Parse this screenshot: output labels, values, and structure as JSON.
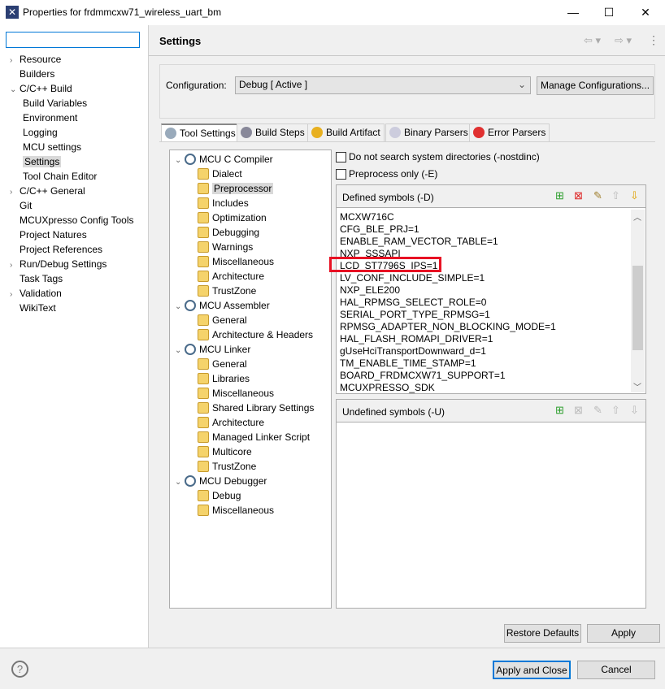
{
  "window": {
    "title": "Properties for frdmmcxw71_wireless_uart_bm",
    "minimize": "—",
    "maximize": "☐",
    "close": "✕"
  },
  "left_tree": [
    {
      "label": "Resource",
      "level": 0,
      "arrow": ">"
    },
    {
      "label": "Builders",
      "level": 0,
      "arrow": ""
    },
    {
      "label": "C/C++ Build",
      "level": 0,
      "arrow": "v"
    },
    {
      "label": "Build Variables",
      "level": 1,
      "arrow": ""
    },
    {
      "label": "Environment",
      "level": 1,
      "arrow": ""
    },
    {
      "label": "Logging",
      "level": 1,
      "arrow": ""
    },
    {
      "label": "MCU settings",
      "level": 1,
      "arrow": ""
    },
    {
      "label": "Settings",
      "level": 1,
      "arrow": "",
      "selected": true
    },
    {
      "label": "Tool Chain Editor",
      "level": 1,
      "arrow": ""
    },
    {
      "label": "C/C++ General",
      "level": 0,
      "arrow": ">"
    },
    {
      "label": "Git",
      "level": 0,
      "arrow": ""
    },
    {
      "label": "MCUXpresso Config Tools",
      "level": 0,
      "arrow": ""
    },
    {
      "label": "Project Natures",
      "level": 0,
      "arrow": ""
    },
    {
      "label": "Project References",
      "level": 0,
      "arrow": ""
    },
    {
      "label": "Run/Debug Settings",
      "level": 0,
      "arrow": ">"
    },
    {
      "label": "Task Tags",
      "level": 0,
      "arrow": ""
    },
    {
      "label": "Validation",
      "level": 0,
      "arrow": ">"
    },
    {
      "label": "WikiText",
      "level": 0,
      "arrow": ""
    }
  ],
  "header": {
    "title": "Settings",
    "back": "⇦ ▾",
    "forward": "⇨ ▾",
    "menu": "⋮"
  },
  "configuration": {
    "label": "Configuration:",
    "value": "Debug  [ Active ]",
    "manage": "Manage Configurations..."
  },
  "tabs": [
    {
      "label": "Tool Settings",
      "active": true,
      "icon": "tool-settings-icon"
    },
    {
      "label": "Build Steps",
      "icon": "build-steps-icon"
    },
    {
      "label": "Build Artifact",
      "icon": "trophy-icon"
    },
    {
      "label": "Binary Parsers",
      "icon": "binary-icon"
    },
    {
      "label": "Error Parsers",
      "icon": "error-icon"
    }
  ],
  "tool_tree": [
    {
      "label": "MCU C Compiler",
      "tool": true
    },
    {
      "label": "Dialect"
    },
    {
      "label": "Preprocessor",
      "selected": true
    },
    {
      "label": "Includes"
    },
    {
      "label": "Optimization"
    },
    {
      "label": "Debugging"
    },
    {
      "label": "Warnings"
    },
    {
      "label": "Miscellaneous"
    },
    {
      "label": "Architecture"
    },
    {
      "label": "TrustZone"
    },
    {
      "label": "MCU Assembler",
      "tool": true
    },
    {
      "label": "General"
    },
    {
      "label": "Architecture & Headers"
    },
    {
      "label": "MCU Linker",
      "tool": true
    },
    {
      "label": "General"
    },
    {
      "label": "Libraries"
    },
    {
      "label": "Miscellaneous"
    },
    {
      "label": "Shared Library Settings"
    },
    {
      "label": "Architecture"
    },
    {
      "label": "Managed Linker Script"
    },
    {
      "label": "Multicore"
    },
    {
      "label": "TrustZone"
    },
    {
      "label": "MCU Debugger",
      "tool": true
    },
    {
      "label": "Debug"
    },
    {
      "label": "Miscellaneous"
    }
  ],
  "options": {
    "nostdinc": "Do not search system directories (-nostdinc)",
    "preprocess_only": "Preprocess only (-E)"
  },
  "defined": {
    "title": "Defined symbols (-D)",
    "symbols": [
      "MCXW716C",
      "CFG_BLE_PRJ=1",
      "ENABLE_RAM_VECTOR_TABLE=1",
      "NXP_SSSAPI",
      "LCD_ST7796S_IPS=1",
      "LV_CONF_INCLUDE_SIMPLE=1",
      "NXP_ELE200",
      "HAL_RPMSG_SELECT_ROLE=0",
      "SERIAL_PORT_TYPE_RPMSG=1",
      "RPMSG_ADAPTER_NON_BLOCKING_MODE=1",
      "HAL_FLASH_ROMAPI_DRIVER=1",
      "gUseHciTransportDownward_d=1",
      "TM_ENABLE_TIME_STAMP=1",
      "BOARD_FRDMCXW71_SUPPORT=1",
      "MCUXPRESSO_SDK"
    ],
    "highlighted": "LCD_ST7796S_IPS=1",
    "highlight_color": "#e81123"
  },
  "undefined": {
    "title": "Undefined symbols (-U)",
    "symbols": []
  },
  "buttons": {
    "restore": "Restore Defaults",
    "apply": "Apply",
    "apply_close": "Apply and Close",
    "cancel": "Cancel",
    "help": "?"
  }
}
